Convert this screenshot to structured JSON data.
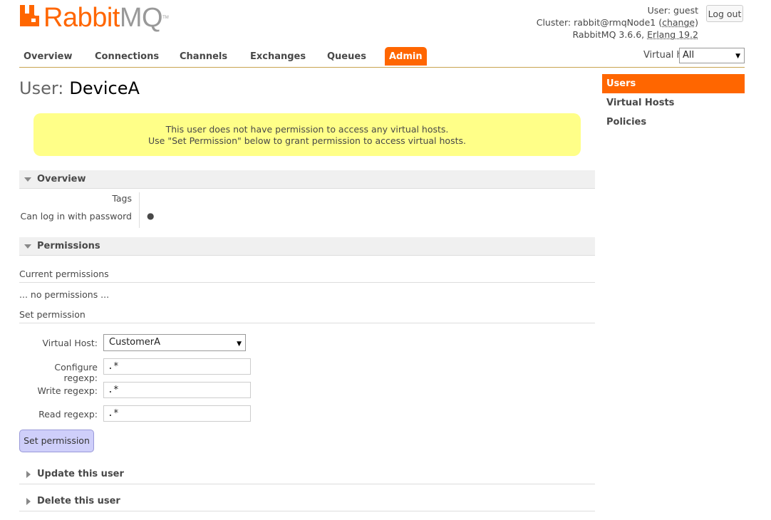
{
  "header": {
    "logo_brand": "Rabbit",
    "logo_mq": "MQ",
    "logo_tm": "TM",
    "user_label": "User:",
    "user_name": "guest",
    "cluster_label": "Cluster:",
    "cluster_name": "rabbit@rmqNode1",
    "cluster_change": "change",
    "version": "RabbitMQ 3.6.6,",
    "erlang": "Erlang 19.2",
    "logout": "Log out"
  },
  "nav": {
    "tabs": [
      "Overview",
      "Connections",
      "Channels",
      "Exchanges",
      "Queues",
      "Admin"
    ],
    "active": "Admin",
    "vhost_label": "Virtual host:",
    "vhost_value": "All"
  },
  "sidebar": {
    "items": [
      "Users",
      "Virtual Hosts",
      "Policies"
    ],
    "active": "Users"
  },
  "page": {
    "title_prefix": "User:",
    "title_name": "DeviceA",
    "warning_line1": "This user does not have permission to access any virtual hosts.",
    "warning_line2": "Use \"Set Permission\" below to grant permission to access virtual hosts."
  },
  "overview": {
    "heading": "Overview",
    "tags_label": "Tags",
    "tags_value": "",
    "password_label": "Can log in with password",
    "password_value": "●"
  },
  "permissions": {
    "heading": "Permissions",
    "current_title": "Current permissions",
    "no_permissions": "... no permissions ...",
    "set_title": "Set permission",
    "vhost_label": "Virtual Host:",
    "vhost_value": "CustomerA",
    "configure_label": "Configure regexp:",
    "configure_value": ".*",
    "write_label": "Write regexp:",
    "write_value": ".*",
    "read_label": "Read regexp:",
    "read_value": ".*",
    "button": "Set permission"
  },
  "collapsed_sections": {
    "update": "Update this user",
    "delete": "Delete this user"
  },
  "colors": {
    "accent": "#ff6600",
    "warning_bg": "#ffff88",
    "button_bg": "#cfcffa"
  }
}
